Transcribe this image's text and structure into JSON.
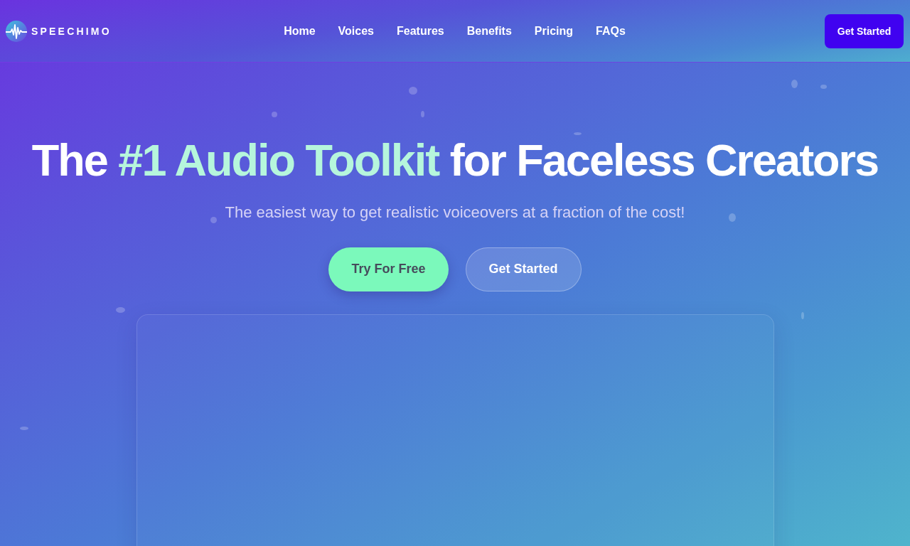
{
  "header": {
    "logo": {
      "text": "SPEECHIMO"
    },
    "nav": [
      {
        "label": "Home"
      },
      {
        "label": "Voices"
      },
      {
        "label": "Features"
      },
      {
        "label": "Benefits"
      },
      {
        "label": "Pricing"
      },
      {
        "label": "FAQs"
      }
    ],
    "cta": {
      "label": "Get Started"
    }
  },
  "hero": {
    "title": [
      {
        "text": "The ",
        "highlight": false
      },
      {
        "text": "#1 Audio Toolkit",
        "highlight": true
      },
      {
        "text": " for Faceless Creators",
        "highlight": false
      }
    ],
    "subtitle": "The easiest way to get realistic voiceovers at a fraction of the cost!",
    "buttons": [
      {
        "label": "Try For Free",
        "kind": "primary"
      },
      {
        "label": "Get Started",
        "kind": "secondary"
      }
    ]
  }
}
